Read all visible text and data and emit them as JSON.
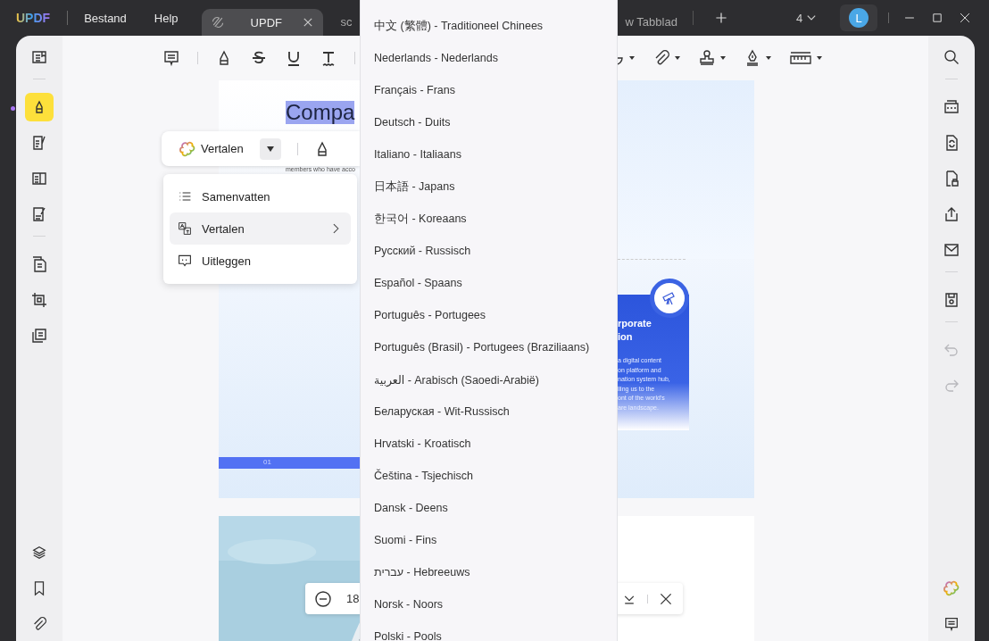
{
  "title_bar": {
    "logo": "UPDF",
    "menus": [
      "Bestand",
      "Help"
    ],
    "tabs": [
      {
        "label": "UPDF",
        "selected": true
      },
      {
        "label": "sc",
        "selected": false
      },
      {
        "label": "w Tabblad",
        "selected": false
      }
    ],
    "page_count": "4",
    "avatar": "L"
  },
  "left_sidebar": {
    "items": [
      {
        "selected": false
      },
      {
        "selected": true
      },
      {
        "selected": false
      },
      {
        "selected": false
      },
      {
        "selected": false
      },
      {
        "selected": false
      },
      {
        "selected": false
      },
      {
        "selected": false
      }
    ]
  },
  "right_sidebar": {
    "items": [
      {
        "disabled": false
      },
      {
        "disabled": false
      },
      {
        "disabled": false
      },
      {
        "disabled": false
      },
      {
        "disabled": false
      },
      {
        "disabled": false
      },
      {
        "disabled": false
      },
      {
        "disabled": true
      },
      {
        "disabled": true
      }
    ]
  },
  "document": {
    "heading": "Compa",
    "subtext": "members who have acco",
    "page_number": "01",
    "card_title": [
      "rporate",
      "ion"
    ],
    "card_text": [
      "a digital content",
      "on platform and",
      "nation system hub,",
      "lling us to the",
      "ont of the world's",
      "are landscape."
    ]
  },
  "selection_toolbar": {
    "action": "Vertalen"
  },
  "context_menu": {
    "items": [
      {
        "label": "Samenvatten",
        "selected": false,
        "submenu": false
      },
      {
        "label": "Vertalen",
        "selected": true,
        "submenu": true
      },
      {
        "label": "Uitleggen",
        "selected": false,
        "submenu": false
      }
    ]
  },
  "language_menu": {
    "items": [
      "中文 (繁體) - Traditioneel Chinees",
      "Nederlands - Nederlands",
      "Français - Frans",
      "Deutsch - Duits",
      "Italiano - Italiaans",
      "日本語 - Japans",
      "한국어 - Koreaans",
      "Русский - Russisch",
      "Español - Spaans",
      "Português - Portugees",
      "Português (Brasil) - Portugees (Braziliaans)",
      "العربية - Arabisch (Saoedi-Arabië)",
      "Беларуская - Wit-Russisch",
      "Hrvatski - Kroatisch",
      "Čeština - Tsjechisch",
      "Dansk - Deens",
      "Suomi - Fins",
      "עברית - Hebreeuws",
      "Norsk - Noors",
      "Polski - Pools"
    ]
  },
  "zoom_bar": {
    "zoom": "18"
  }
}
